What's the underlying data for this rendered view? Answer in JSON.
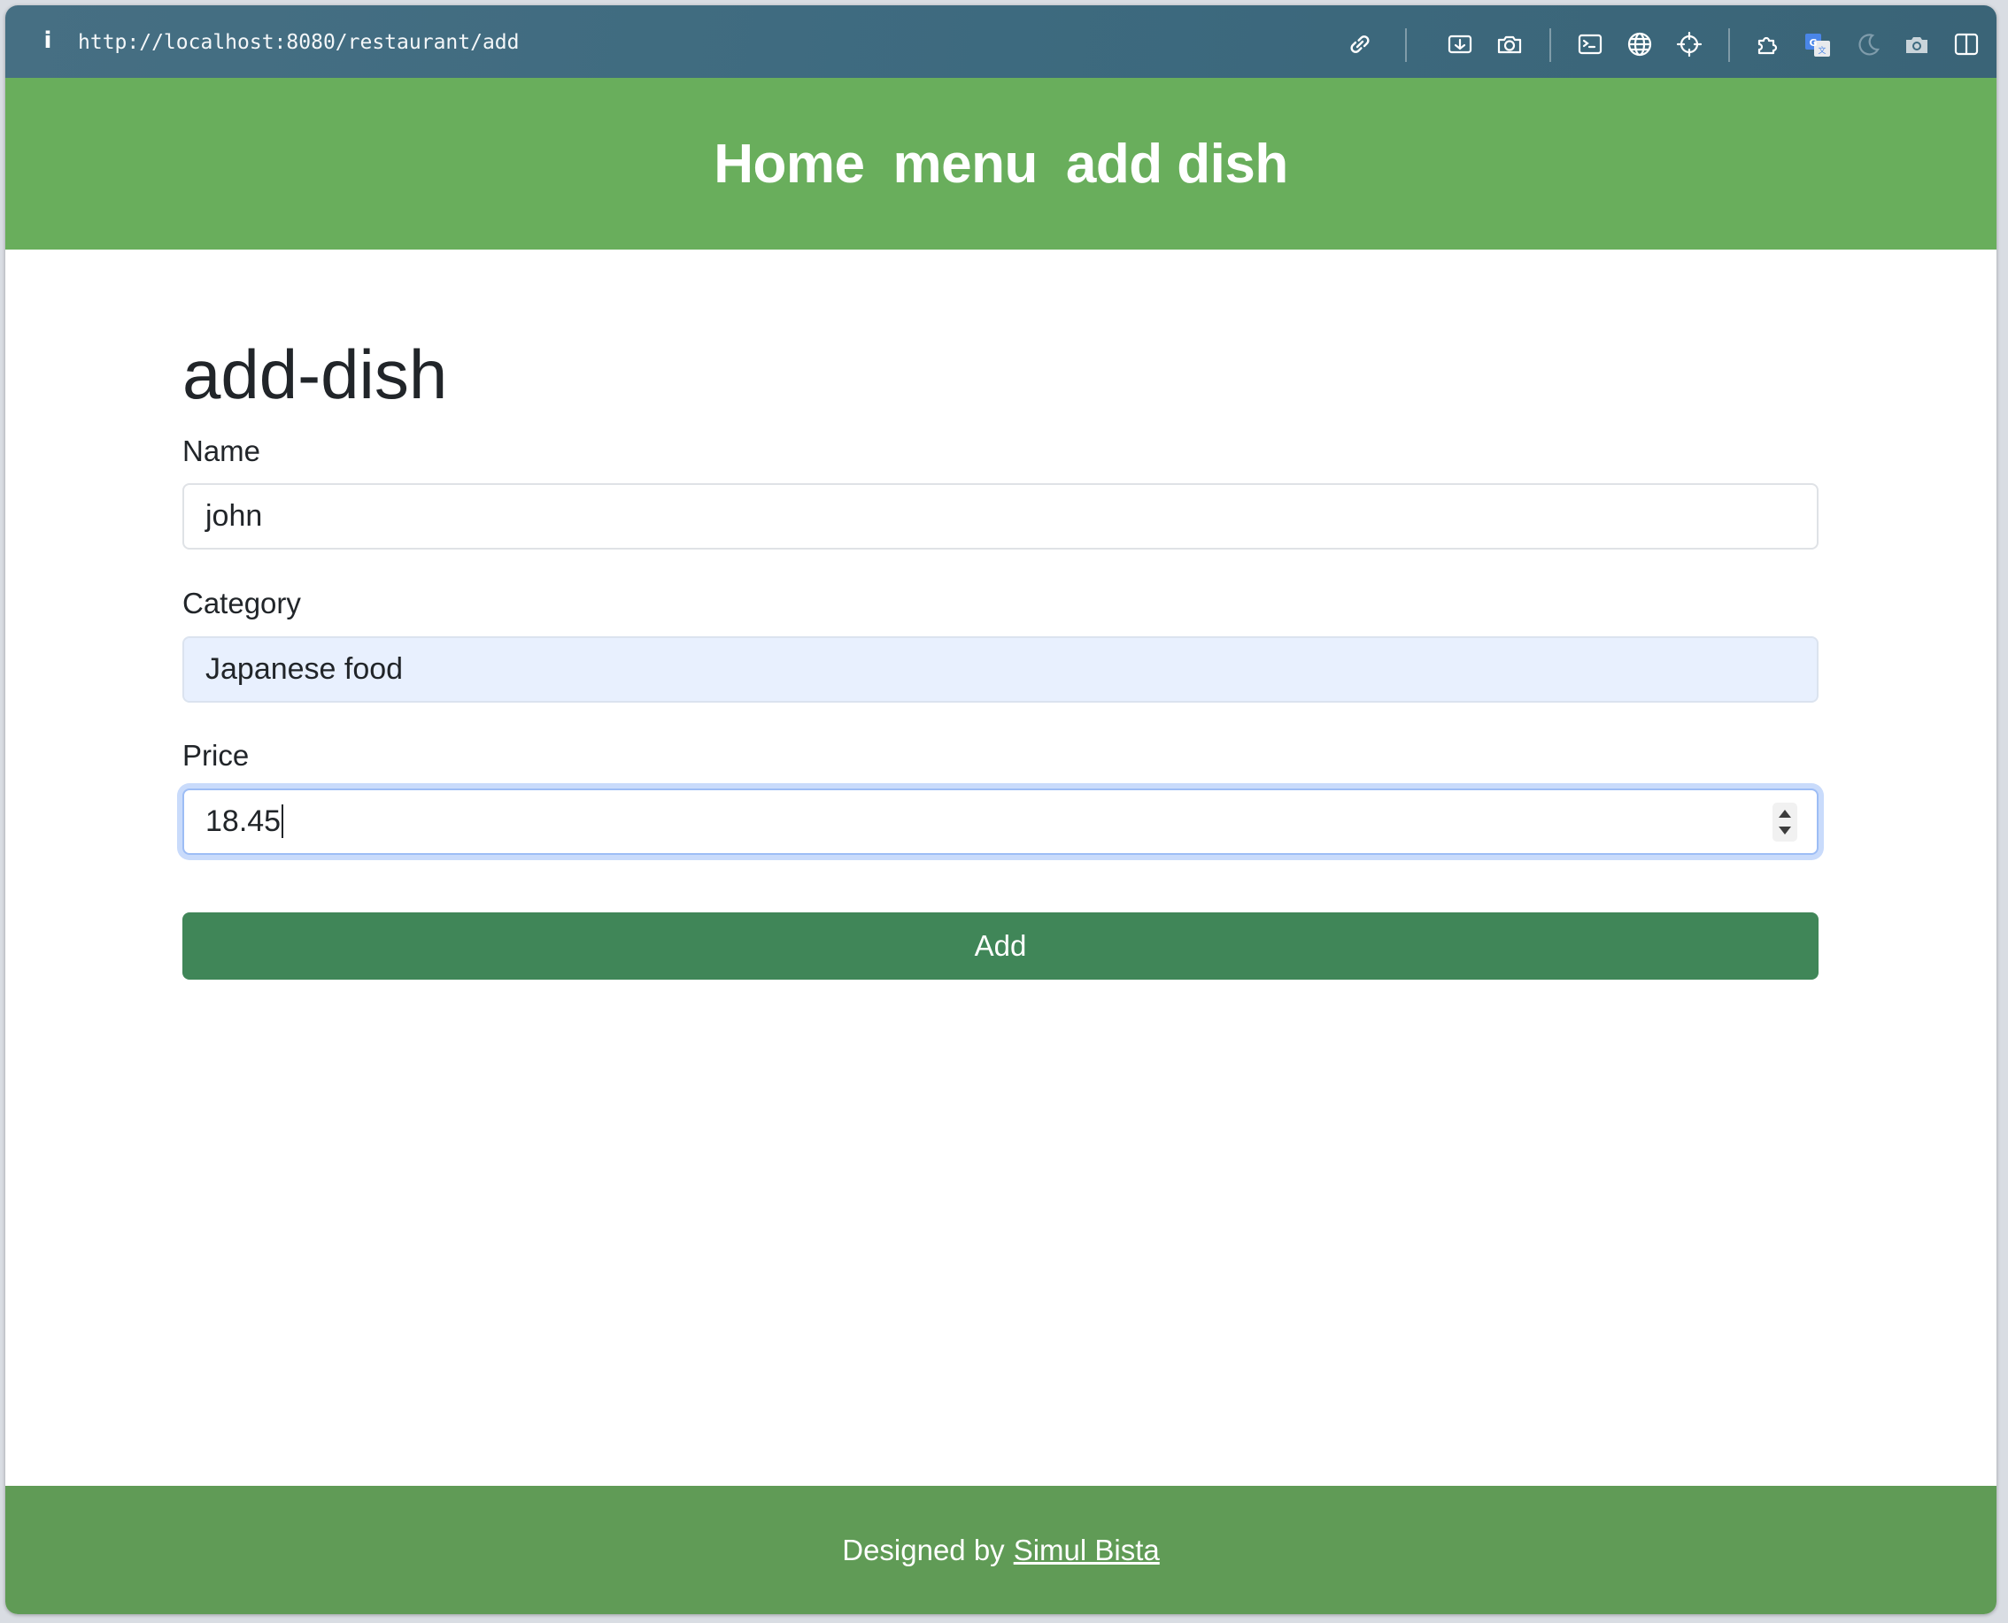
{
  "browser": {
    "url": "http://localhost:8080/restaurant/add",
    "info_glyph": "i",
    "toolbar_icons": [
      "link-icon",
      "screen-capture-icon",
      "camera-icon",
      "terminal-icon",
      "globe-icon",
      "crosshair-icon",
      "extensions-icon",
      "translate-icon",
      "moon-icon",
      "camera-alt-icon",
      "sidebar-icon"
    ]
  },
  "nav": {
    "home": "Home",
    "menu": "menu",
    "add_dish": "add dish"
  },
  "page": {
    "title": "add-dish"
  },
  "form": {
    "name_label": "Name",
    "name_value": "john",
    "category_label": "Category",
    "category_value": "Japanese food",
    "price_label": "Price",
    "price_value": "18.45",
    "submit_label": "Add"
  },
  "footer": {
    "prefix": "Designed by",
    "author": "Simul Bista"
  },
  "colors": {
    "header_bg": "#69ae5c",
    "footer_bg": "#609b56",
    "button_bg": "#408658",
    "browser_bar": "#3d6a7f",
    "autofill_bg": "#e8f0fe",
    "focus_ring": "#9dbdf5"
  }
}
